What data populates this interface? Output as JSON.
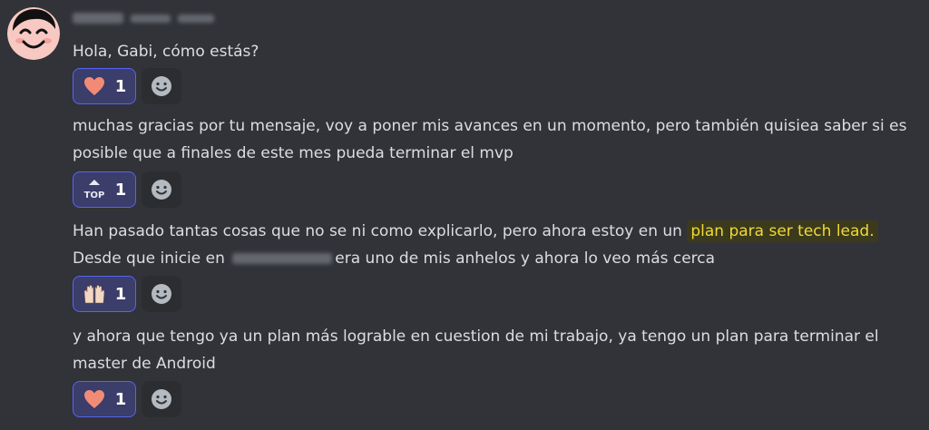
{
  "messages": [
    {
      "text": "Hola, Gabi, cómo estás?",
      "reaction": {
        "icon": "heart-emoji",
        "count": "1"
      }
    },
    {
      "text": "muchas gracias por tu mensaje, voy a poner mis avances en un momento, pero también quisiea saber si es posible que a finales de este mes pueda terminar el mvp",
      "reaction": {
        "icon": "top-emoji",
        "count": "1"
      }
    },
    {
      "text_before": "Han pasado tantas cosas que no se ni como explicarlo, pero ahora estoy en un ",
      "highlight": "plan para ser tech lead.",
      "line2_before": "Desde que inicie en ",
      "line2_after": "era uno de mis anhelos y ahora lo veo más cerca",
      "reaction": {
        "icon": "raising-hands-emoji",
        "count": "1"
      }
    },
    {
      "text": "y ahora que tengo ya un plan más lograble en cuestion de mi trabajo, ya tengo un plan para terminar el master de Android",
      "reaction": {
        "icon": "heart-emoji",
        "count": "1"
      }
    }
  ],
  "colors": {
    "background": "#313338",
    "reaction_bg": "#3b3d6a",
    "reaction_border": "#5865f2",
    "highlight_text": "#f0d83a"
  }
}
